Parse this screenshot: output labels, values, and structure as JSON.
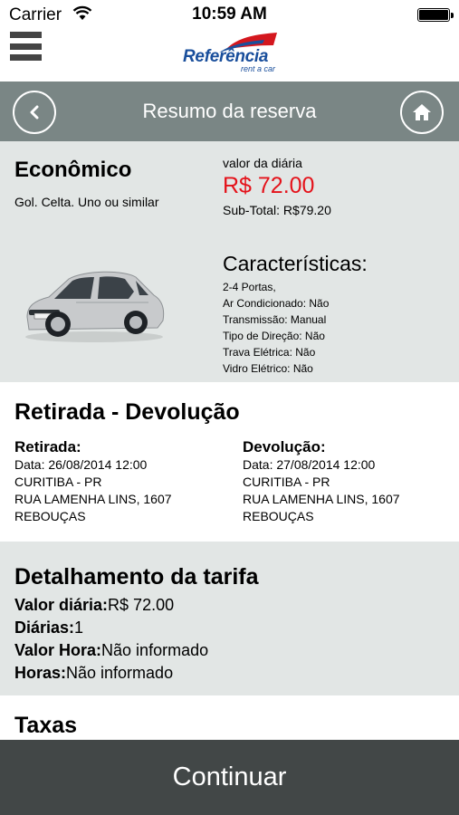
{
  "status_bar": {
    "carrier": "Carrier",
    "time": "10:59 AM"
  },
  "header": {
    "logo_text": "Referência",
    "logo_subtext": "rent a car",
    "logo_accent_color": "#d4171e",
    "logo_text_color": "#1a4f9c"
  },
  "nav": {
    "title": "Resumo da reserva",
    "back_icon": "chevron-left-icon",
    "home_icon": "home-icon",
    "bar_color": "#7a8685"
  },
  "car": {
    "category": "Econômico",
    "models": "Gol. Celta. Uno ou similar",
    "daily_label": "valor da diária",
    "daily_price": "R$ 72.00",
    "subtotal": "Sub-Total: R$79.20",
    "features_title": "Características:",
    "features": [
      "2-4 Portas,",
      "Ar Condicionado: Não",
      "Transmissão: Manual",
      "Tipo de Direção: Não",
      "Trava Elétrica: Não",
      "Vidro Elétrico: Não"
    ],
    "price_color": "#e4121a"
  },
  "pickup_return": {
    "title": "Retirada - Devolução",
    "pickup": {
      "heading": "Retirada:",
      "date": "Data: 26/08/2014 12:00",
      "city": "CURITIBA - PR",
      "street": "RUA LAMENHA LINS, 1607",
      "district": "REBOUÇAS"
    },
    "return": {
      "heading": "Devolução:",
      "date": "Data: 27/08/2014 12:00",
      "city": "CURITIBA - PR",
      "street": "RUA LAMENHA LINS, 1607",
      "district": "REBOUÇAS"
    }
  },
  "tariff": {
    "title": "Detalhamento da tarifa",
    "rows": [
      {
        "label": "Valor diária:",
        "value": "R$ 72.00"
      },
      {
        "label": "Diárias:",
        "value": "1"
      },
      {
        "label": "Valor Hora:",
        "value": "Não informado"
      },
      {
        "label": "Horas:",
        "value": "Não informado"
      }
    ]
  },
  "taxes": {
    "title": "Taxas"
  },
  "footer": {
    "continue_label": "Continuar",
    "button_color": "#424747"
  }
}
